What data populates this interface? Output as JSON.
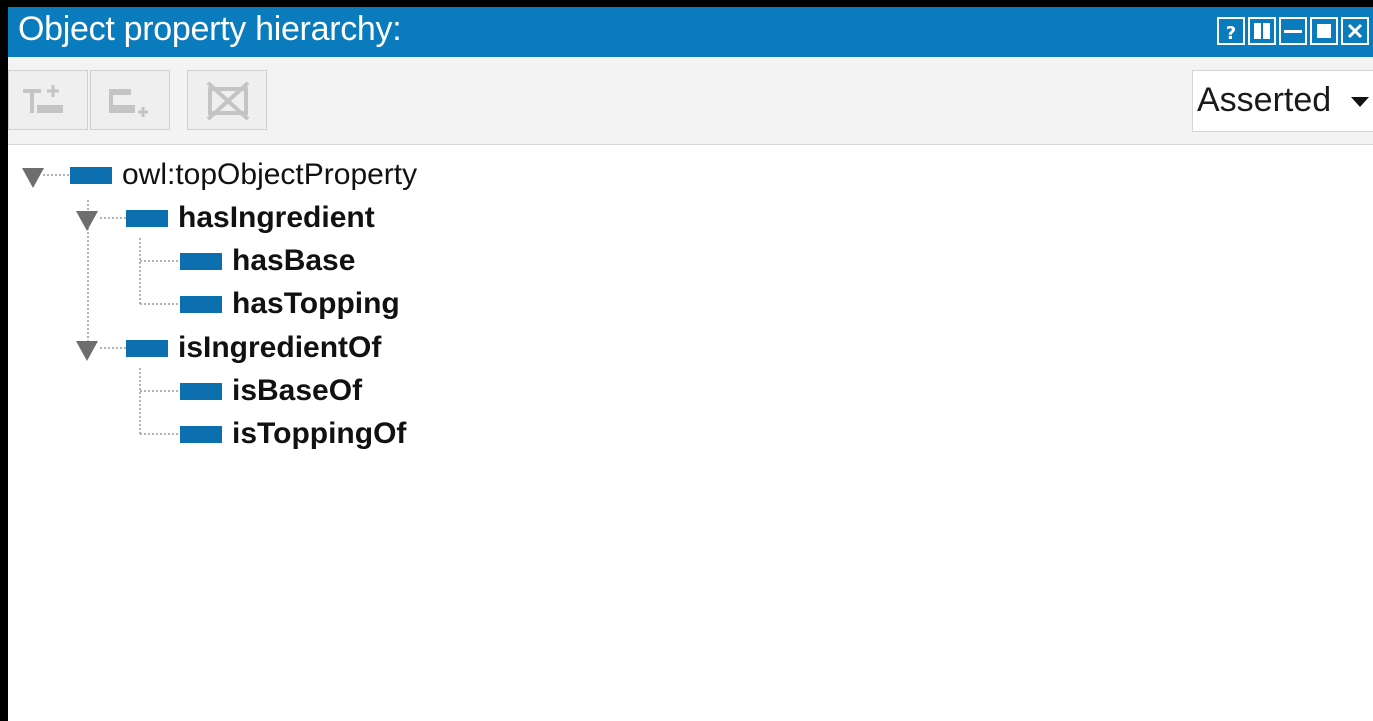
{
  "panel": {
    "title": "Object property hierarchy:",
    "window_buttons": [
      "help",
      "split-vertical",
      "split-horizontal",
      "maximize",
      "close"
    ]
  },
  "toolbar": {
    "buttons": [
      {
        "name": "add-sub-property",
        "icon": "add-child-icon",
        "enabled": false
      },
      {
        "name": "add-sibling-property",
        "icon": "add-sibling-icon",
        "enabled": false
      },
      {
        "name": "delete-property",
        "icon": "delete-icon",
        "enabled": false
      }
    ],
    "view_mode": "Asserted"
  },
  "tree": {
    "root": {
      "label": "owl:topObjectProperty",
      "expanded": true
    },
    "nodes": [
      {
        "label": "hasIngredient",
        "expanded": true,
        "bold": true
      },
      {
        "label": "hasBase",
        "bold": true
      },
      {
        "label": "hasTopping",
        "bold": true
      },
      {
        "label": "isIngredientOf",
        "expanded": true,
        "bold": true
      },
      {
        "label": "isBaseOf",
        "bold": true
      },
      {
        "label": "isToppingOf",
        "bold": true
      }
    ]
  },
  "colors": {
    "title_bar": "#0a7cbd",
    "property_icon": "#0b6fb0",
    "expander": "#6e6e6e"
  }
}
